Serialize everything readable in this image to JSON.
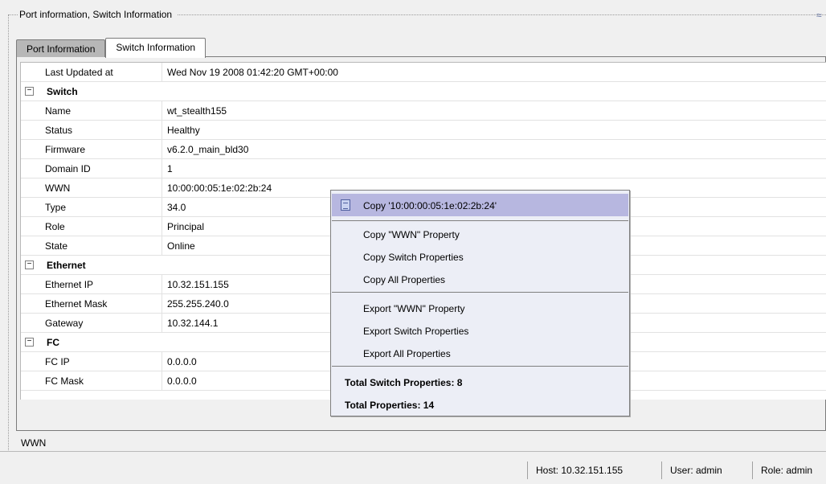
{
  "group": {
    "title": "Port information, Switch Information",
    "corner_glyph": "≈"
  },
  "tabs": [
    {
      "label": "Port Information",
      "active": false
    },
    {
      "label": "Switch Information",
      "active": true
    }
  ],
  "rows": {
    "last_updated": {
      "key": "Last Updated at",
      "value": "Wed Nov 19 2008 01:42:20 GMT+00:00"
    },
    "switch": {
      "title": "Switch",
      "toggle": "−",
      "name": {
        "key": "Name",
        "value": "wt_stealth155"
      },
      "status": {
        "key": "Status",
        "value": "Healthy"
      },
      "firmware": {
        "key": "Firmware",
        "value": "v6.2.0_main_bld30"
      },
      "domain_id": {
        "key": "Domain ID",
        "value": "1"
      },
      "wwn": {
        "key": "WWN",
        "value": "10:00:00:05:1e:02:2b:24"
      },
      "type": {
        "key": "Type",
        "value": "34.0"
      },
      "role": {
        "key": "Role",
        "value": "Principal"
      },
      "state": {
        "key": "State",
        "value": "Online"
      }
    },
    "ethernet": {
      "title": "Ethernet",
      "toggle": "−",
      "ip": {
        "key": "Ethernet IP",
        "value": "10.32.151.155"
      },
      "mask": {
        "key": "Ethernet Mask",
        "value": "255.255.240.0"
      },
      "gateway": {
        "key": "Gateway",
        "value": "10.32.144.1"
      }
    },
    "fc": {
      "title": "FC",
      "toggle": "−",
      "ip": {
        "key": "FC IP",
        "value": "0.0.0.0"
      },
      "mask": {
        "key": "FC Mask",
        "value": "0.0.0.0"
      }
    }
  },
  "status_text": "WWN",
  "bottombar": {
    "host": "Host: 10.32.151.155",
    "user": "User: admin",
    "role": "Role: admin"
  },
  "context_menu": {
    "copy_value": "Copy '10:00:00:05:1e:02:2b:24'",
    "copy_wwn_property": "Copy \"WWN\" Property",
    "copy_switch_properties": "Copy Switch Properties",
    "copy_all_properties": "Copy All Properties",
    "export_wwn_property": "Export \"WWN\" Property",
    "export_switch_properties": "Export Switch Properties",
    "export_all_properties": "Export All Properties",
    "total_switch_properties": "Total Switch Properties: 8",
    "total_properties": "Total Properties: 14"
  }
}
